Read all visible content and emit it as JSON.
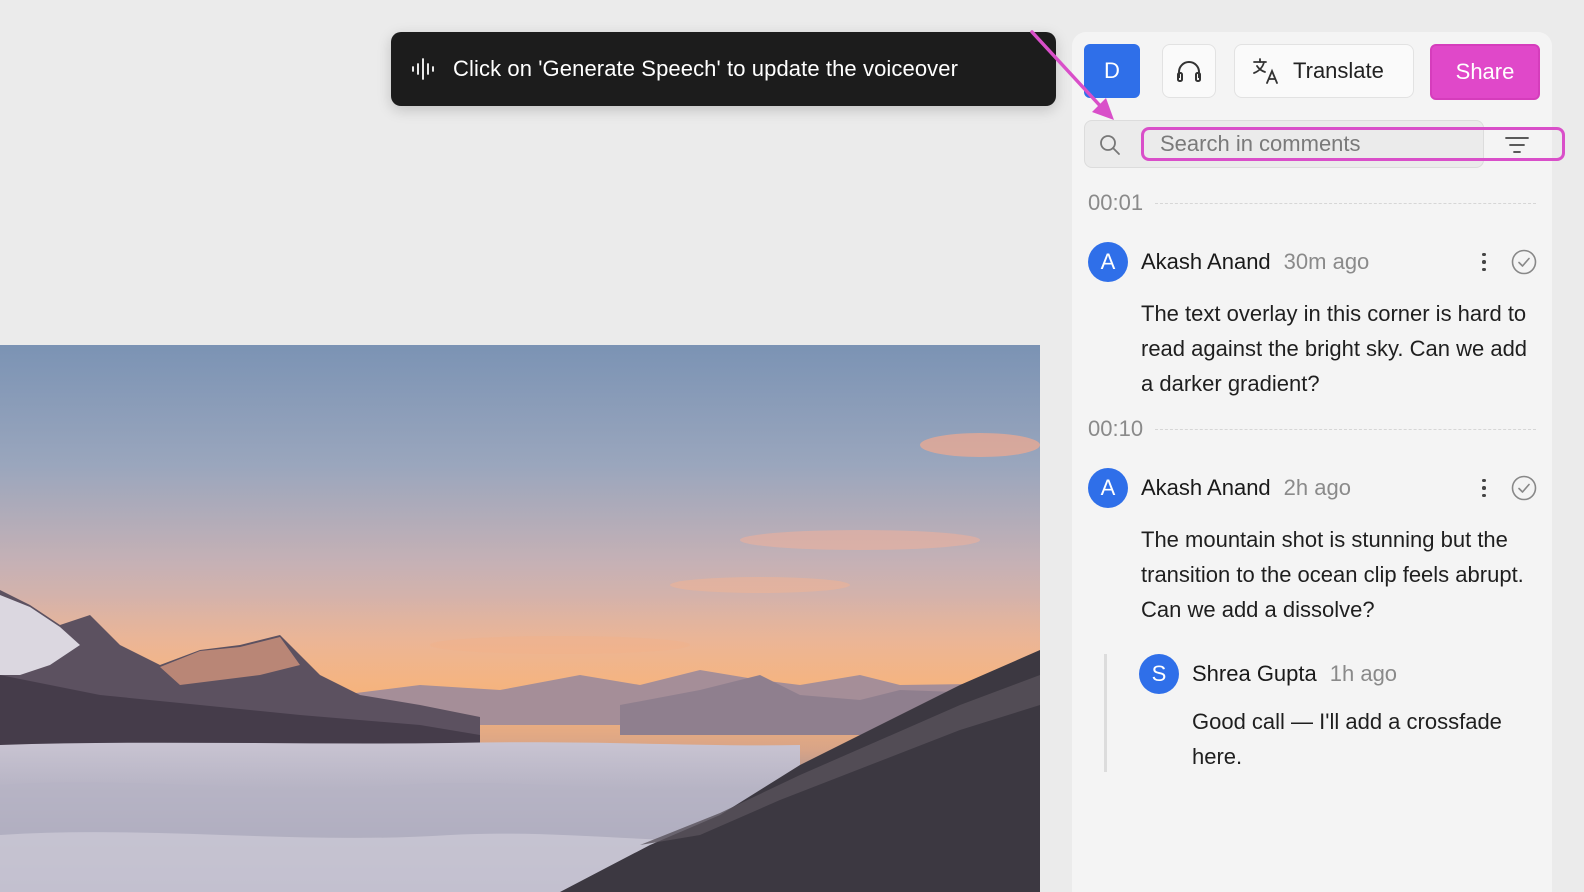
{
  "toast": {
    "message": "Click on 'Generate Speech' to update the voiceover",
    "icon": "waveform-icon"
  },
  "header": {
    "user_initial": "D",
    "listen_icon": "headphones-icon",
    "translate_label": "Translate",
    "translate_icon": "translate-icon",
    "share_label": "Share"
  },
  "search": {
    "placeholder": "Search in comments",
    "value": ""
  },
  "comments": {
    "groups": [
      {
        "timestamp": "00:01",
        "author_initial": "A",
        "author": "Akash Anand",
        "time": "30m ago",
        "text": "The text overlay in this corner is hard to read against the bright sky. Can we add a darker gradient?"
      },
      {
        "timestamp": "00:10",
        "author_initial": "A",
        "author": "Akash Anand",
        "time": "2h ago",
        "text": "The mountain shot is stunning but the transition to the ocean clip feels abrupt. Can we add a dissolve?",
        "reply": {
          "author_initial": "S",
          "author": "Shrea Gupta",
          "time": "1h ago",
          "text": "Good call — I'll add a crossfade here."
        }
      }
    ]
  },
  "colors": {
    "accent_pink": "#e048c9",
    "avatar_blue": "#2f6fe9",
    "toast_bg": "#1c1c1c"
  }
}
